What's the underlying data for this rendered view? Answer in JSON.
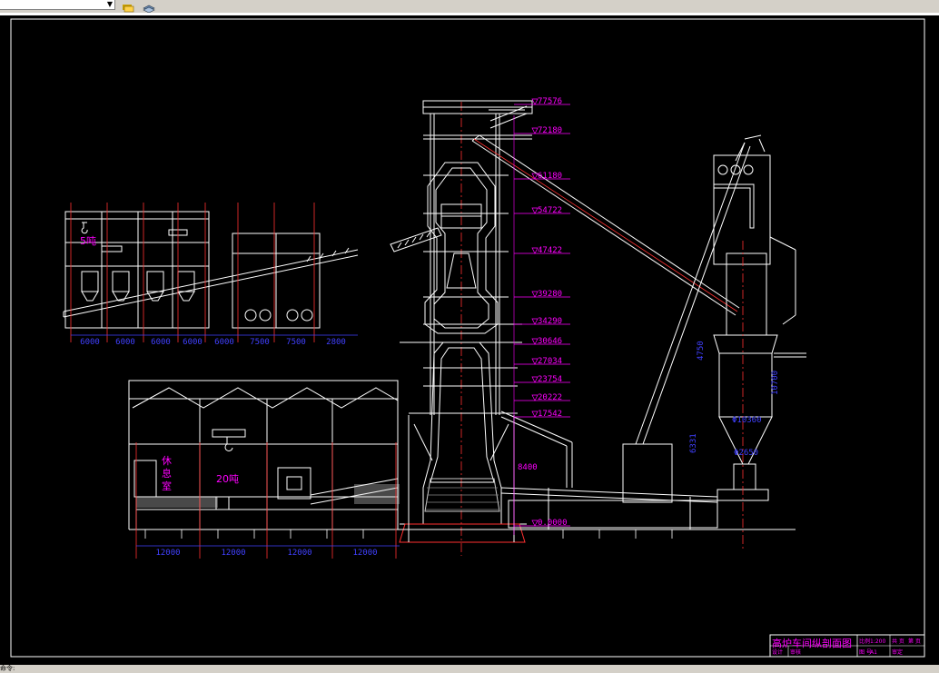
{
  "toolbar": {
    "combo_value": "",
    "icons": [
      "layer-stack-icon",
      "layers-icon"
    ]
  },
  "drawing": {
    "elevations": [
      "77576",
      "72180",
      "61180",
      "54722",
      "47422",
      "39280",
      "34290",
      "30646",
      "27034",
      "23754",
      "20222",
      "17542",
      "8400",
      "0.0000"
    ],
    "top_dims": [
      "6000",
      "6000",
      "6000",
      "6000",
      "6000",
      "7500",
      "7500",
      "2800"
    ],
    "bottom_dims": [
      "12000",
      "12000",
      "12000",
      "12000"
    ],
    "labels": {
      "crane_small": "5吨",
      "crane_large": "20吨",
      "rest_room": [
        "休",
        "息",
        "室"
      ]
    },
    "right_dims": [
      "Φ10360",
      "4750",
      "10700",
      "6331",
      "Φ2650"
    ],
    "mid_dims": [
      "8400"
    ]
  },
  "title_block": {
    "title": "高炉车间纵剖面图",
    "cells": [
      "比例",
      "1:200",
      "共 页",
      "第 页",
      "图 号",
      "A1",
      "设计",
      "审核",
      "审定"
    ]
  },
  "status": {
    "text": "命令:"
  }
}
